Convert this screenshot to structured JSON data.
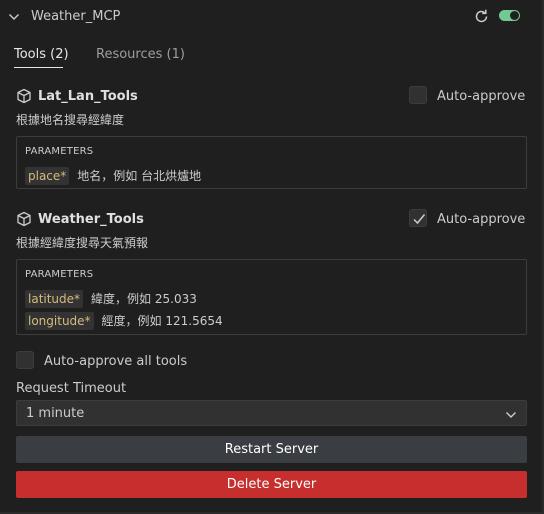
{
  "header": {
    "server_name": "Weather_MCP",
    "enabled": true,
    "colors": {
      "toggle_on": "#73c991"
    }
  },
  "tabs": [
    {
      "label": "Tools (2)",
      "active": true
    },
    {
      "label": "Resources (1)",
      "active": false
    }
  ],
  "tools": [
    {
      "name": "Lat_Lan_Tools",
      "description": "根據地名搜尋經緯度",
      "auto_approve_label": "Auto-approve",
      "auto_approve": false,
      "params_title": "PARAMETERS",
      "params": [
        {
          "name": "place*",
          "description": "地名，例如 台北烘爐地"
        }
      ]
    },
    {
      "name": "Weather_Tools",
      "description": "根據經緯度搜尋天氣預報",
      "auto_approve_label": "Auto-approve",
      "auto_approve": true,
      "params_title": "PARAMETERS",
      "params": [
        {
          "name": "latitude*",
          "description": "緯度，例如 25.033"
        },
        {
          "name": "longitude*",
          "description": "經度，例如 121.5654"
        }
      ]
    }
  ],
  "auto_approve_all": {
    "label": "Auto-approve all tools",
    "checked": false
  },
  "request_timeout": {
    "label": "Request Timeout",
    "value": "1 minute"
  },
  "buttons": {
    "restart": "Restart Server",
    "delete": "Delete Server",
    "colors": {
      "delete": "#c72e2e",
      "restart": "#3a3d41"
    }
  }
}
